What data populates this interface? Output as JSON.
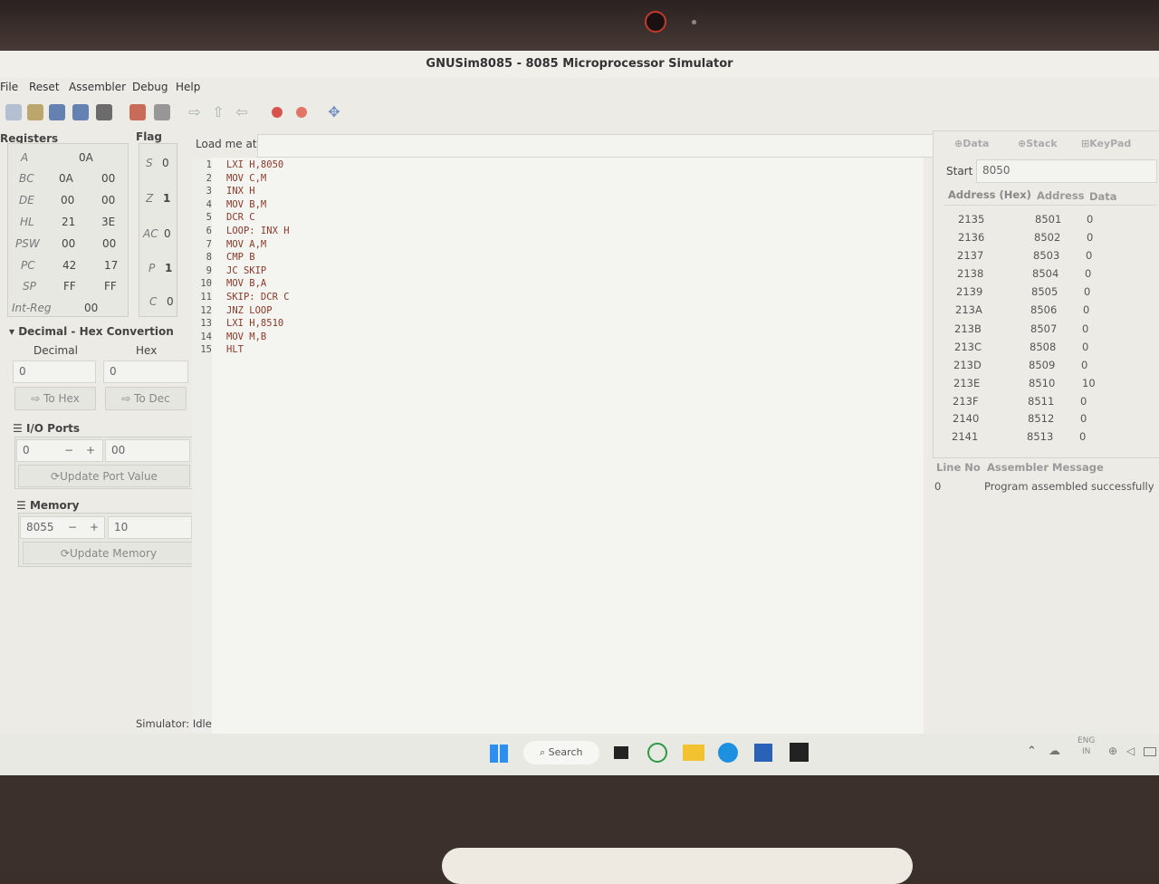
{
  "window": {
    "title": "GNUSim8085 - 8085 Microprocessor Simulator"
  },
  "menu": [
    "File",
    "Reset",
    "Assembler",
    "Debug",
    "Help"
  ],
  "registers": {
    "title": "Registers",
    "rows": [
      {
        "name": "A",
        "v1": "0A",
        "v2": ""
      },
      {
        "name": "BC",
        "v1": "0A",
        "v2": "00"
      },
      {
        "name": "DE",
        "v1": "00",
        "v2": "00"
      },
      {
        "name": "HL",
        "v1": "21",
        "v2": "3E"
      },
      {
        "name": "PSW",
        "v1": "00",
        "v2": "00"
      },
      {
        "name": "PC",
        "v1": "42",
        "v2": "17"
      },
      {
        "name": "SP",
        "v1": "FF",
        "v2": "FF"
      },
      {
        "name": "Int-Reg",
        "v1": "00",
        "v2": ""
      }
    ]
  },
  "flags": {
    "title": "Flag",
    "rows": [
      {
        "name": "S",
        "value": "0"
      },
      {
        "name": "Z",
        "value": "1"
      },
      {
        "name": "AC",
        "value": "0"
      },
      {
        "name": "P",
        "value": "1"
      },
      {
        "name": "C",
        "value": "0"
      }
    ]
  },
  "load": {
    "label": "Load me at",
    "value": ""
  },
  "conversion": {
    "title": "Decimal - Hex Convertion",
    "decimal_label": "Decimal",
    "hex_label": "Hex",
    "decimal_value": "0",
    "hex_value": "0",
    "to_hex": "To Hex",
    "to_dec": "To Dec"
  },
  "io": {
    "title": "I/O Ports",
    "port": "0",
    "minus": "−",
    "plus": "+",
    "value": "00",
    "update": "Update Port Value"
  },
  "memory": {
    "title": "Memory",
    "address": "8055",
    "minus": "−",
    "plus": "+",
    "value": "10",
    "update": "Update Memory"
  },
  "code": [
    {
      "n": "1",
      "text": "LXI H,8050"
    },
    {
      "n": "2",
      "text": "MOV C,M"
    },
    {
      "n": "3",
      "text": "INX H"
    },
    {
      "n": "4",
      "text": "MOV B,M"
    },
    {
      "n": "5",
      "text": "DCR C"
    },
    {
      "n": "6",
      "text": "LOOP: INX H"
    },
    {
      "n": "7",
      "text": "MOV A,M"
    },
    {
      "n": "8",
      "text": "CMP B"
    },
    {
      "n": "9",
      "text": "JC SKIP"
    },
    {
      "n": "10",
      "text": "MOV B,A"
    },
    {
      "n": "11",
      "text": "SKIP: DCR C"
    },
    {
      "n": "12",
      "text": "JNZ LOOP"
    },
    {
      "n": "13",
      "text": "LXI H,8510"
    },
    {
      "n": "14",
      "text": "MOV M,B"
    },
    {
      "n": "15",
      "text": "HLT"
    }
  ],
  "tabs": [
    "Data",
    "Stack",
    "KeyPad"
  ],
  "data_panel": {
    "start_label": "Start",
    "start_value": "8050",
    "headers": [
      "Address (Hex)",
      "Address",
      "Data"
    ],
    "rows": [
      [
        "2135",
        "8501",
        "0"
      ],
      [
        "2136",
        "8502",
        "0"
      ],
      [
        "2137",
        "8503",
        "0"
      ],
      [
        "2138",
        "8504",
        "0"
      ],
      [
        "2139",
        "8505",
        "0"
      ],
      [
        "213A",
        "8506",
        "0"
      ],
      [
        "213B",
        "8507",
        "0"
      ],
      [
        "213C",
        "8508",
        "0"
      ],
      [
        "213D",
        "8509",
        "0"
      ],
      [
        "213E",
        "8510",
        "10"
      ],
      [
        "213F",
        "8511",
        "0"
      ],
      [
        "2140",
        "8512",
        "0"
      ],
      [
        "2141",
        "8513",
        "0"
      ]
    ]
  },
  "messages": {
    "headers": [
      "Line No",
      "Assembler Message"
    ],
    "rows": [
      [
        "0",
        "Program assembled successfully"
      ]
    ]
  },
  "status": "Simulator: Idle",
  "taskbar": {
    "search": "Search",
    "lang1": "ENG",
    "lang2": "IN"
  }
}
